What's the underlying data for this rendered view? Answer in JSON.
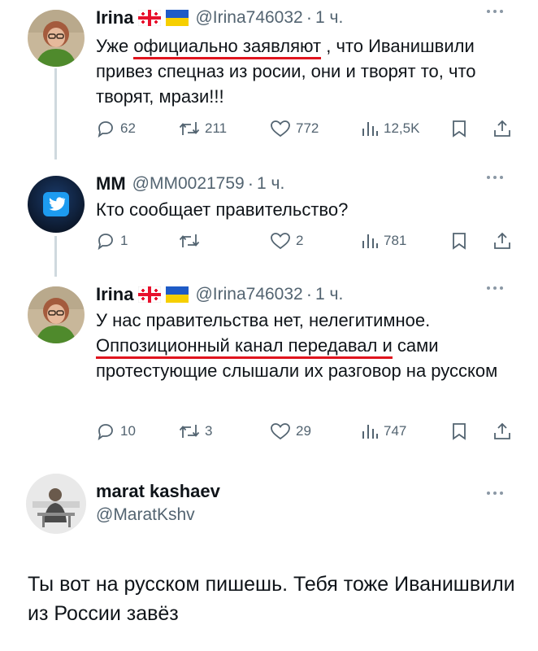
{
  "tweets": [
    {
      "name": "Irina",
      "handle": "@Irina746032",
      "time": "1 ч.",
      "text_a": "Уже ",
      "text_u": "официально заявляют",
      "text_b": " , что Иванишвили привез спецназ из росии, они и творят то, что творят, мрази!!!",
      "replies": "62",
      "retweets": "211",
      "likes": "772",
      "views": "12,5K"
    },
    {
      "name": "MM",
      "handle": "@MM0021759",
      "time": "1 ч.",
      "text": "Кто сообщает правительство?",
      "replies": "1",
      "retweets": "",
      "likes": "2",
      "views": "781"
    },
    {
      "name": "Irina",
      "handle": "@Irina746032",
      "time": "1 ч.",
      "text_a": "У нас правительства нет, нелегитимное. ",
      "text_u": "Оппозиционный канал передавал и",
      "text_b": " сами протестующие слышали их разговор на русском",
      "replies": "10",
      "retweets": "3",
      "likes": "29",
      "views": "747"
    },
    {
      "name": "marat kashaev",
      "handle": "@MaratKshv",
      "text": "Ты вот на русском пишешь. Тебя тоже Иванишвили из России завёз"
    }
  ],
  "colors": {
    "underline": "#e0141e",
    "secondary": "#536471",
    "twitter_blue": "#1d9bf0",
    "thread_line": "#cfd9de"
  },
  "icons": [
    "reply-icon",
    "retweet-icon",
    "like-icon",
    "views-icon",
    "bookmark-icon",
    "share-icon",
    "more-icon",
    "georgia-flag-icon",
    "ukraine-flag-icon",
    "twitter-bird-icon"
  ]
}
